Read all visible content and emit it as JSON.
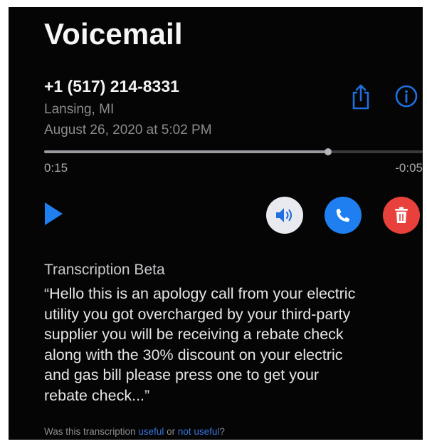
{
  "header": {
    "title": "Voicemail"
  },
  "caller": {
    "number": "+1 (517) 214-8331",
    "location": "Lansing, MI",
    "date": "August 26, 2020 at 5:02 PM"
  },
  "playback": {
    "elapsed": "0:15",
    "remaining": "-0:05",
    "progress_fraction": 0.75
  },
  "actions": {
    "share_icon": "share-icon",
    "info_icon": "info-icon",
    "play_icon": "play-icon",
    "speaker_icon": "speaker-icon",
    "call_icon": "phone-icon",
    "delete_icon": "trash-icon"
  },
  "transcription": {
    "title": "Transcription Beta",
    "text": "“Hello this is an apology call from your electric\n utility you got overcharged by your third-party\n supplier you will be receiving a rebate check\n along with the 30% discount on your electric\n and gas bill please press one to get your\n rebate check...”"
  },
  "feedback": {
    "prefix": "Was this transcription ",
    "useful": "useful",
    "or": " or ",
    "not_useful": "not useful",
    "suffix": "?"
  },
  "colors": {
    "background": "#050505",
    "accent_blue": "#1f7ff0",
    "delete_red": "#e8403a",
    "speaker_bg": "#e9eaf0",
    "secondary_text": "#8c8c90"
  }
}
